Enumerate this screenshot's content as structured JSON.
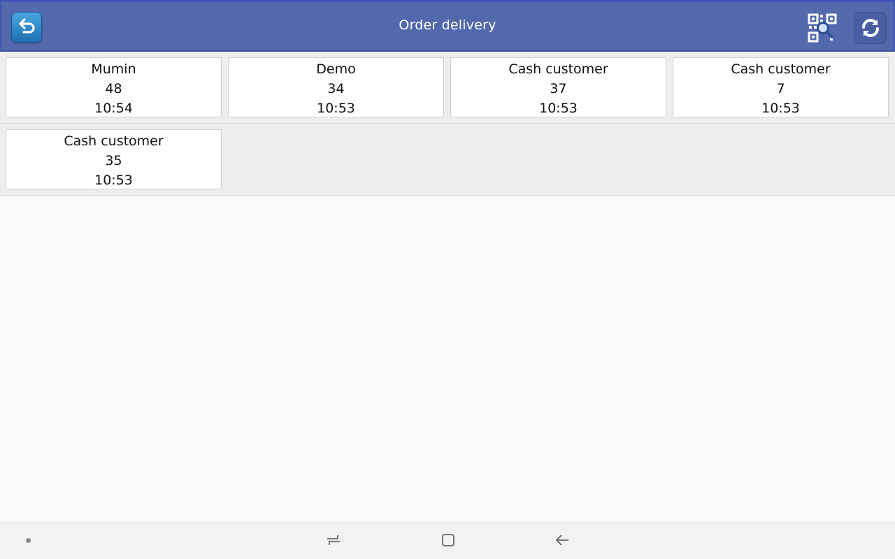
{
  "header": {
    "title": "Order delivery",
    "icons": {
      "back": "back-arrow-icon",
      "qr": "qr-search-icon",
      "refresh": "refresh-icon"
    }
  },
  "orders": [
    {
      "customer": "Mumin",
      "number": "48",
      "time": "10:54"
    },
    {
      "customer": "Demo",
      "number": "34",
      "time": "10:53"
    },
    {
      "customer": "Cash customer",
      "number": "37",
      "time": "10:53"
    },
    {
      "customer": "Cash customer",
      "number": "7",
      "time": "10:53"
    },
    {
      "customer": "Cash customer",
      "number": "35",
      "time": "10:53"
    }
  ],
  "navbar": {
    "icons": [
      "recents-icon",
      "home-icon",
      "back-icon"
    ]
  },
  "colors": {
    "header": "#5468ad",
    "row_background": "#eeeeee",
    "card_background": "#ffffff",
    "page_background": "#fafafa"
  }
}
